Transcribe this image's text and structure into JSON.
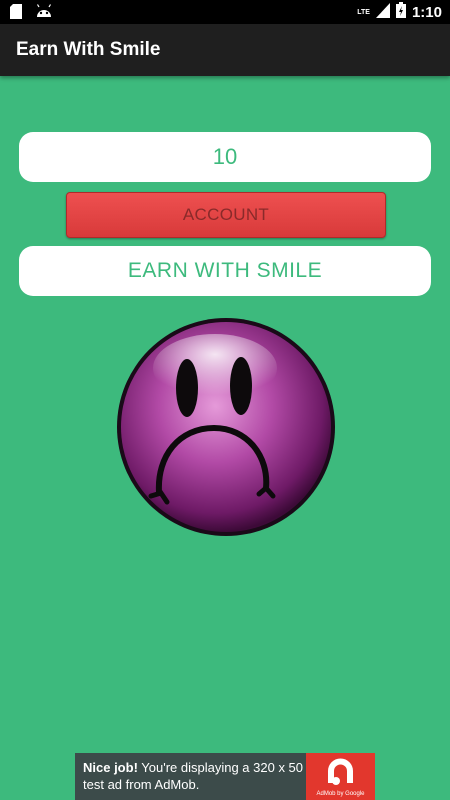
{
  "status_bar": {
    "time": "1:10",
    "network": "LTE",
    "icons": [
      "sd-card-icon",
      "android-icon",
      "signal-icon",
      "battery-icon"
    ]
  },
  "app_bar": {
    "title": "Earn With Smile"
  },
  "main": {
    "count_value": "10",
    "account_label": "ACCOUNT",
    "earn_label": "EARN WITH SMILE",
    "smiley_state": "sad"
  },
  "ad": {
    "headline": "Nice job!",
    "body": " You're displaying a 320 x 50 test ad from AdMob.",
    "brand": "AdMob by Google"
  },
  "colors": {
    "background": "#3dba7d",
    "app_bar": "#1f1f1f",
    "button_red": "#e04545",
    "smiley_purple": "#a93a9f",
    "ad_background": "#3c4b4a",
    "ad_logo": "#e2372d"
  }
}
